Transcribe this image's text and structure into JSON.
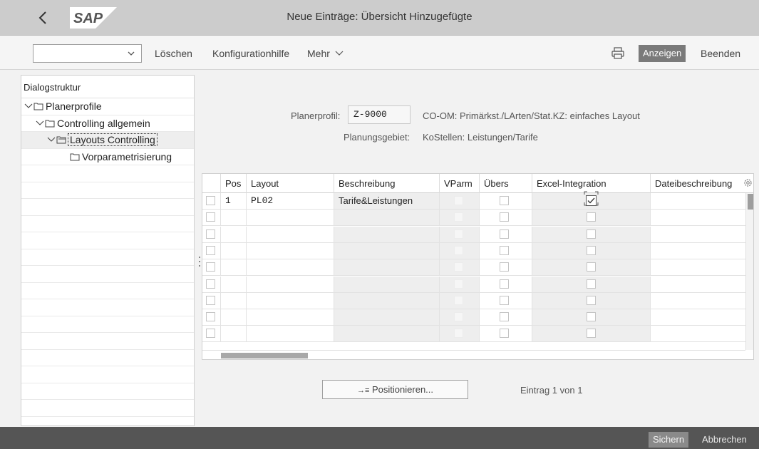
{
  "title": "Neue Einträge: Übersicht Hinzugefügte",
  "logo_text": "SAP",
  "toolbar": {
    "command_value": "",
    "delete_label": "Löschen",
    "config_help_label": "Konfigurationhilfe",
    "more_label": "Mehr",
    "display_label": "Anzeigen",
    "exit_label": "Beenden"
  },
  "dialog_structure": {
    "title": "Dialogstruktur",
    "items": [
      {
        "label": "Planerprofile",
        "level": 0
      },
      {
        "label": "Controlling allgemein",
        "level": 1
      },
      {
        "label": "Layouts Controlling",
        "level": 2,
        "selected": true
      },
      {
        "label": "Vorparametrisierung",
        "level": 3
      }
    ]
  },
  "header": {
    "profile_label": "Planerprofil:",
    "profile_value": "Z-9000",
    "profile_desc": "CO-OM: Primärkst./LArten/Stat.KZ: einfaches Layout",
    "area_label": "Planungsgebiet:",
    "area_value": "KoStellen: Leistungen/Tarife"
  },
  "table": {
    "columns": [
      "Pos",
      "Layout",
      "Beschreibung",
      "VParm",
      "Übers",
      "Excel-Integration",
      "Dateibeschreibung"
    ],
    "rows": [
      {
        "pos": "1",
        "layout": "PL02",
        "desc": "Tarife&Leistungen",
        "vparm": false,
        "uebers": false,
        "excel": true,
        "file_desc": ""
      },
      {
        "pos": "",
        "layout": "",
        "desc": "",
        "vparm": false,
        "uebers": false,
        "excel": false,
        "file_desc": ""
      },
      {
        "pos": "",
        "layout": "",
        "desc": "",
        "vparm": false,
        "uebers": false,
        "excel": false,
        "file_desc": ""
      },
      {
        "pos": "",
        "layout": "",
        "desc": "",
        "vparm": false,
        "uebers": false,
        "excel": false,
        "file_desc": ""
      },
      {
        "pos": "",
        "layout": "",
        "desc": "",
        "vparm": false,
        "uebers": false,
        "excel": false,
        "file_desc": ""
      },
      {
        "pos": "",
        "layout": "",
        "desc": "",
        "vparm": false,
        "uebers": false,
        "excel": false,
        "file_desc": ""
      },
      {
        "pos": "",
        "layout": "",
        "desc": "",
        "vparm": false,
        "uebers": false,
        "excel": false,
        "file_desc": ""
      },
      {
        "pos": "",
        "layout": "",
        "desc": "",
        "vparm": false,
        "uebers": false,
        "excel": false,
        "file_desc": ""
      },
      {
        "pos": "",
        "layout": "",
        "desc": "",
        "vparm": false,
        "uebers": false,
        "excel": false,
        "file_desc": ""
      }
    ]
  },
  "position_button": "Positionieren...",
  "entry_status": "Eintrag 1 von 1",
  "footer": {
    "save_label": "Sichern",
    "cancel_label": "Abbrechen"
  },
  "colors": {
    "titlebar": "#cccccc",
    "footer": "#555555",
    "accent_button": "#7a7a7a"
  }
}
